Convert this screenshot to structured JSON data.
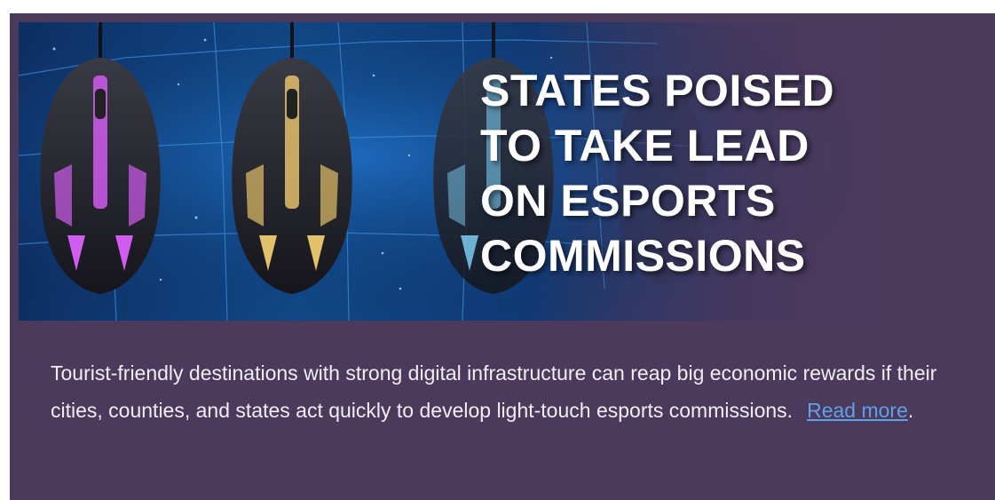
{
  "banner": {
    "headline_lines": [
      "STATES POISED",
      "TO TAKE LEAD",
      "ON ESPORTS",
      "COMMISSIONS"
    ],
    "image_icon": "gaming-mice-over-us-map",
    "mouse_accents": [
      "#d05cf0",
      "#e3c06a",
      "#7ec4e0"
    ]
  },
  "article": {
    "summary": "Tourist-friendly destinations with strong digital infrastructure can reap big economic rewards if their cities, counties, and states act quickly to develop light-touch esports commissions.",
    "link_label": "Read more",
    "trailing_punct": "."
  },
  "colors": {
    "card_bg": "#4b3a5c",
    "link": "#5fa0e6"
  }
}
